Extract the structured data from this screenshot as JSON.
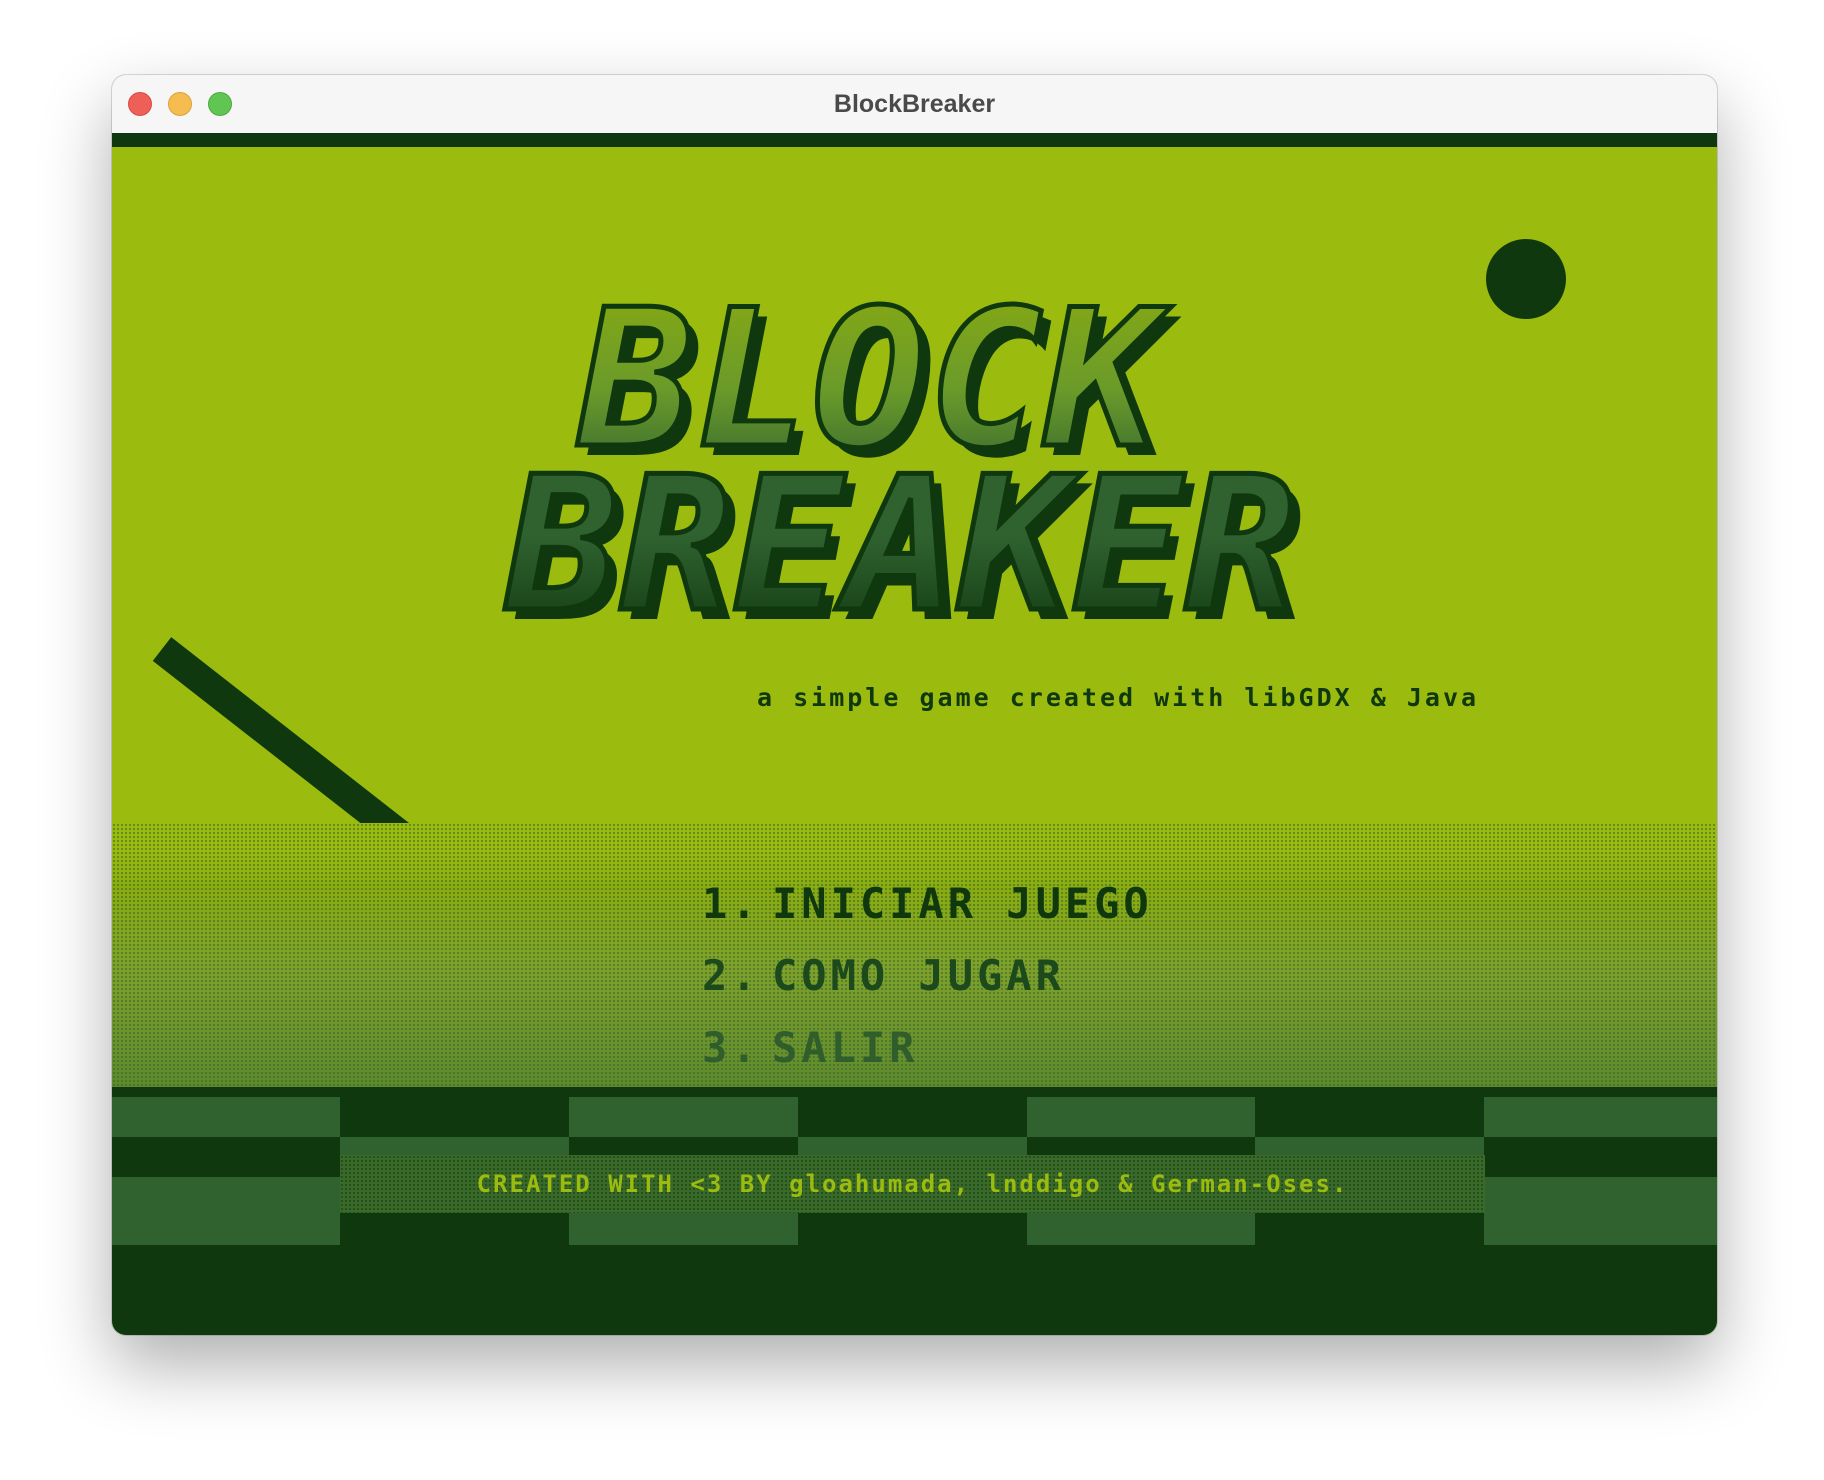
{
  "window": {
    "title": "BlockBreaker"
  },
  "game": {
    "logo_line1": "BLOCK",
    "logo_line2": "BREAKER",
    "subtitle": "a simple game created with libGDX & Java",
    "menu": [
      {
        "number": "1.",
        "label": "INICIAR JUEGO"
      },
      {
        "number": "2.",
        "label": "COMO JUGAR"
      },
      {
        "number": "3.",
        "label": "SALIR"
      }
    ],
    "credits": "CREATED WITH <3 BY gloahumada, lnddigo & German-Oses."
  },
  "palette": {
    "lightest": "#9bbb0f",
    "light": "#8bac0f",
    "dark": "#306230",
    "darkest": "#0f380f"
  }
}
